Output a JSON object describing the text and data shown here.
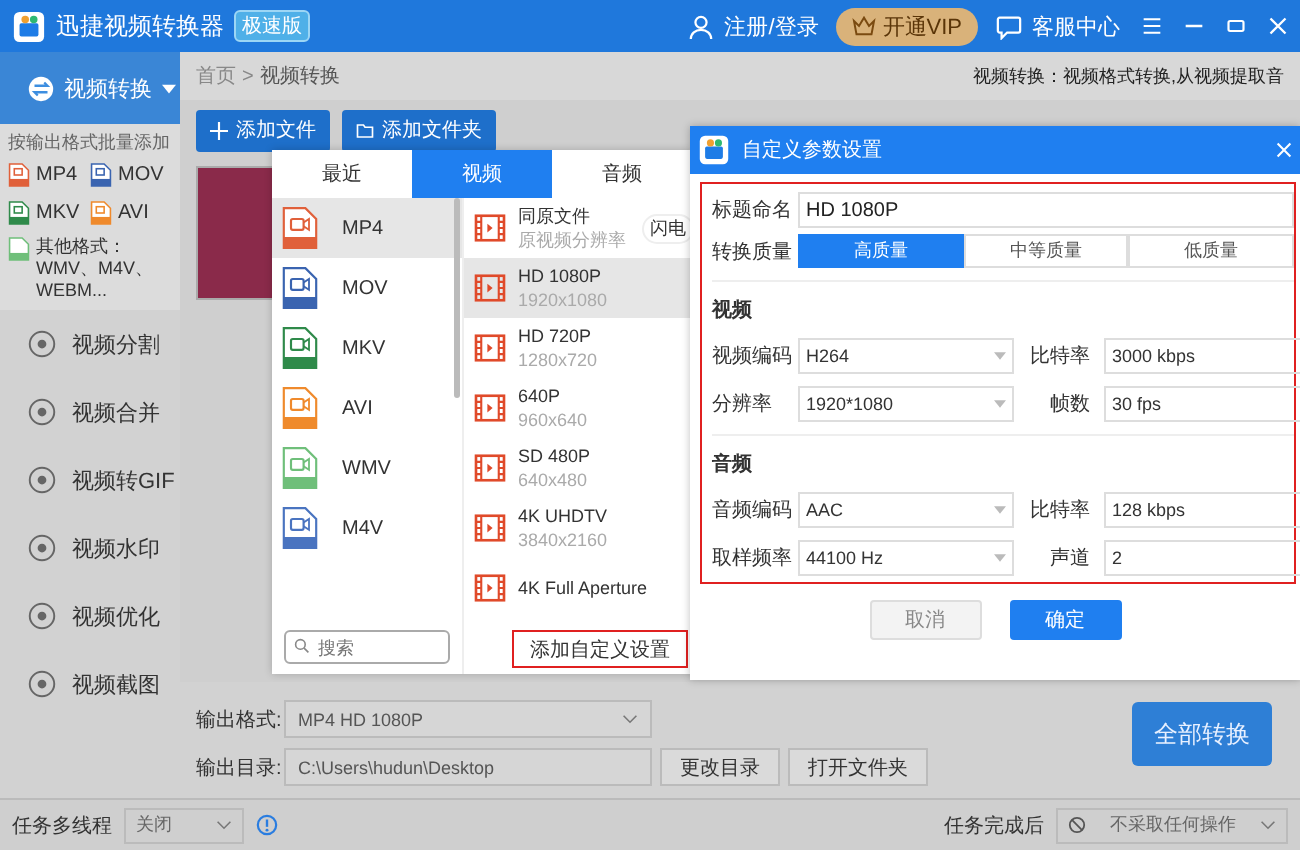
{
  "window": {
    "title": "迅捷视频转换器",
    "edition": "极速版"
  },
  "header": {
    "login": "注册/登录",
    "vip": "开通VIP",
    "support": "客服中心"
  },
  "sidebar": {
    "current": "视频转换",
    "batch_hint": "按输出格式批量添加",
    "formats": [
      {
        "label": "MP4",
        "color": "#e0603a"
      },
      {
        "label": "MOV",
        "color": "#3a64b0"
      },
      {
        "label": "MKV",
        "color": "#2f8a4a"
      },
      {
        "label": "AVI",
        "color": "#ef8a2c"
      }
    ],
    "other_formats": "其他格式：WMV、M4V、WEBM...",
    "items": [
      {
        "label": "视频分割"
      },
      {
        "label": "视频合并"
      },
      {
        "label": "视频转GIF"
      },
      {
        "label": "视频水印"
      },
      {
        "label": "视频优化"
      },
      {
        "label": "视频截图"
      }
    ]
  },
  "breadcrumb": {
    "home": "首页",
    "separator": ">",
    "current": "视频转换"
  },
  "description": "视频转换：视频格式转换,从视频提取音",
  "toolbar": {
    "add_file": "添加文件",
    "add_folder": "添加文件夹"
  },
  "format_picker": {
    "tabs": [
      {
        "label": "最近",
        "selected": false
      },
      {
        "label": "视频",
        "selected": true
      },
      {
        "label": "音频",
        "selected": false
      }
    ],
    "formats": [
      {
        "label": "MP4",
        "color": "#e0603a",
        "selected": true
      },
      {
        "label": "MOV",
        "color": "#3a64b0",
        "selected": false
      },
      {
        "label": "MKV",
        "color": "#2f8a4a",
        "selected": false
      },
      {
        "label": "AVI",
        "color": "#ef8a2c",
        "selected": false
      },
      {
        "label": "WMV",
        "color": "#6fbf7a",
        "selected": false
      },
      {
        "label": "M4V",
        "color": "#4a74c0",
        "selected": false
      }
    ],
    "search_placeholder": "搜索",
    "presets": [
      {
        "name": "同原文件",
        "detail": "原视频分辨率",
        "badge": "闪电",
        "selected": false
      },
      {
        "name": "HD 1080P",
        "detail": "1920x1080",
        "selected": true
      },
      {
        "name": "HD 720P",
        "detail": "1280x720",
        "selected": false
      },
      {
        "name": "640P",
        "detail": "960x640",
        "selected": false
      },
      {
        "name": "SD 480P",
        "detail": "640x480",
        "selected": false
      },
      {
        "name": "4K UHDTV",
        "detail": "3840x2160",
        "selected": false
      },
      {
        "name": "4K Full Aperture",
        "selected": false
      }
    ],
    "add_custom": "添加自定义设置"
  },
  "dialog": {
    "title": "自定义参数设置",
    "name_label": "标题命名",
    "name_value": "HD 1080P",
    "quality_label": "转换质量",
    "qualities": [
      {
        "label": "高质量",
        "selected": true
      },
      {
        "label": "中等质量",
        "selected": false
      },
      {
        "label": "低质量",
        "selected": false
      }
    ],
    "sections": [
      {
        "title": "视频",
        "fields": [
          {
            "label": "视频编码",
            "value": "H264"
          },
          {
            "label": "比特率",
            "value": "3000 kbps"
          },
          {
            "label": "分辨率",
            "value": "1920*1080"
          },
          {
            "label": "帧数",
            "value": "30 fps"
          }
        ]
      },
      {
        "title": "音频",
        "fields": [
          {
            "label": "音频编码",
            "value": "AAC"
          },
          {
            "label": "比特率",
            "value": "128 kbps"
          },
          {
            "label": "取样频率",
            "value": "44100 Hz"
          },
          {
            "label": "声道",
            "value": "2"
          }
        ]
      }
    ],
    "cancel": "取消",
    "ok": "确定"
  },
  "output": {
    "format_label": "输出格式:",
    "format_value": "MP4  HD 1080P",
    "dir_label": "输出目录:",
    "dir_value": "C:\\Users\\hudun\\Desktop",
    "change_dir": "更改目录",
    "open_folder": "打开文件夹",
    "convert_all": "全部转换"
  },
  "status_bar": {
    "threads_label": "任务多线程",
    "threads_value": "关闭",
    "after_label": "任务完成后",
    "after_value": "不采取任何操作"
  }
}
